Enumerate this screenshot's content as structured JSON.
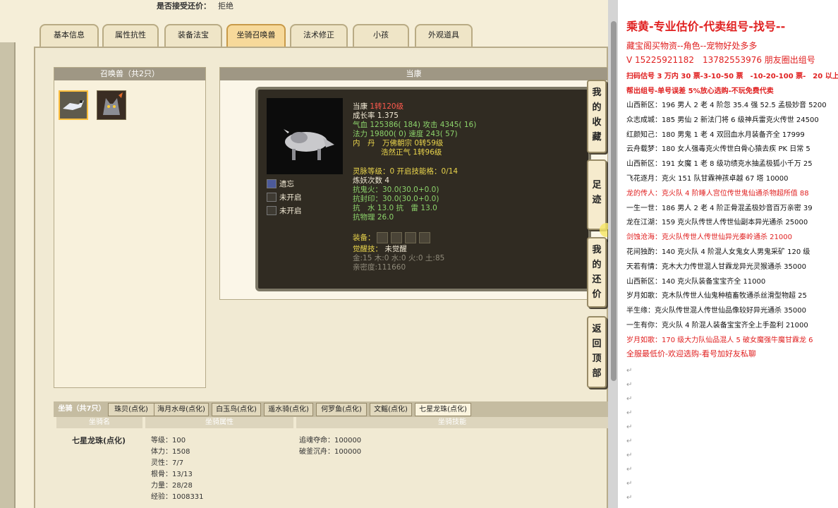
{
  "header": {
    "label": "是否接受还价：",
    "value": "拒绝"
  },
  "tabs": [
    "基本信息",
    "属性抗性",
    "装备法宝",
    "坐骑召唤兽",
    "法术修正",
    "小孩",
    "外观道具"
  ],
  "summon": {
    "title": "召唤兽（共2只）"
  },
  "detail": {
    "title": "当康"
  },
  "tooltip": {
    "name": "当康",
    "level": "1转120级",
    "growth_label": "成长率",
    "growth": "1.375",
    "hp_label": "气血",
    "hp": "125386( 184)",
    "atk_label": "攻击",
    "atk": "4345( 16)",
    "mp_label": "法力",
    "mp": "19800( 0)",
    "spd_label": "速度",
    "spd": "243( 57)",
    "inner_label": "内　丹",
    "inner1": "万佛朝宗 0转59级",
    "inner2": "浩然正气 1转96级",
    "skill1": "遗忘",
    "skill2": "未开启",
    "skill3": "未开启",
    "spirit": "灵脉等级：0 开启技能格：0/14",
    "refine": "炼妖次数 4",
    "res1": "抗鬼火：30.0(30.0+0.0)",
    "res2": "抗封印：30.0(30.0+0.0)",
    "res3": "抗　水 13.0 抗　雷 13.0",
    "res4": "抗物理 26.0",
    "equip_label": "装备：",
    "awaken_label": "觉醒技：",
    "awaken": "未觉醒",
    "five": "金:15 木:0 水:0 火:0 土:85",
    "intimacy": "亲密度:111660"
  },
  "side_buttons": [
    "我的收藏",
    "足迹",
    "我的还价",
    "返回顶部"
  ],
  "mount": {
    "count": "坐骑（共7只）",
    "tabs": [
      "珠贝(点化)",
      "海月水母(点化)",
      "白玉鸟(点化)",
      "遥水骑(点化)",
      "何罗鱼(点化)",
      "文鳐(点化)",
      "七星龙珠(点化)"
    ],
    "headers": [
      "坐骑名",
      "坐骑属性",
      "坐骑技能"
    ],
    "name": "七星龙珠(点化)",
    "attrs": [
      "等级：100",
      "体力：1508",
      "灵性：7/7",
      "根骨：13/13",
      "力量：28/28",
      "经验：1008331"
    ],
    "skills": [
      "追魂夺命：100000",
      "破釜沉舟：100000"
    ]
  },
  "right": {
    "title": "乘黄-专业估价-代卖组号-找号--",
    "line2": "藏宝阁买物资--角色--宠物好处多多",
    "line3": "V 15225921182　13782553976 朋友圈出组号",
    "line4": "扫码估号 3 万内 30 票-3-10-50 票　-10-20-100 票-　20 以上",
    "line5": "帮出组号-单号误差 5%放心选购-不玩免费代卖",
    "listings": [
      {
        "t": "山西新区：196 男人 2 老 4 阶忽 35.4 强 52.5 孟极妙音 5200",
        "red": false
      },
      {
        "t": "众志成城：185 男仙 2 新法门将 6 级神兵雷克火传世 24500",
        "red": false
      },
      {
        "t": "红颜知己：180 男鬼 1 老 4 双回血水月装备齐全 17999",
        "red": false
      },
      {
        "t": "云舟载梦：180 女人强毒克火传世白骨心猿去疾 PK 日常 5",
        "red": false
      },
      {
        "t": "山西新区：191 女魔 1 老 8 级功绩克水抽孟极狐小千万 25",
        "red": false
      },
      {
        "t": "飞花逐月：克火 151 队甘霖神孩卓越 67 塔 10000",
        "red": false
      },
      {
        "t": "龙的传人：克火队 4 阶睡人宫位传世鬼仙通杀物超所值 88",
        "red": true
      },
      {
        "t": "一生一世：186 男人 2 老 4 阶正骨混孟极妙音百万亲密 39",
        "red": false
      },
      {
        "t": "龙在江湖：159 克火队传世人传世仙副本异光通杀 25000",
        "red": false
      },
      {
        "t": "剑蚀沧海：克火队传世人传世仙异光秦岭通杀 21000",
        "red": true
      },
      {
        "t": "花间独酌：140 克火队 4 阶混人女鬼女人男鬼采矿 120 级",
        "red": false
      },
      {
        "t": "天若有情：克木大力传世混人甘霖龙异光灵猴通杀 35000",
        "red": false
      },
      {
        "t": "山西新区：140 克火队装备宝宝齐全 11000",
        "red": false
      },
      {
        "t": "岁月如歌：克木队传世人仙鬼种植畜牧通杀丝滑型物超 25",
        "red": false
      },
      {
        "t": "半生缘：克火队传世混人传世仙品像较好异光通杀 35000",
        "red": false
      },
      {
        "t": "一生有你：克火队 4 阶混人装备宝宝齐全上手盈利 21000",
        "red": false
      },
      {
        "t": "岁月如歌：170 级大力队仙品混人 5 破女魔强牛魔甘霖龙 6",
        "red": true
      }
    ],
    "footer": "全服最低价-欢迎选购-看号加好友私聊"
  }
}
